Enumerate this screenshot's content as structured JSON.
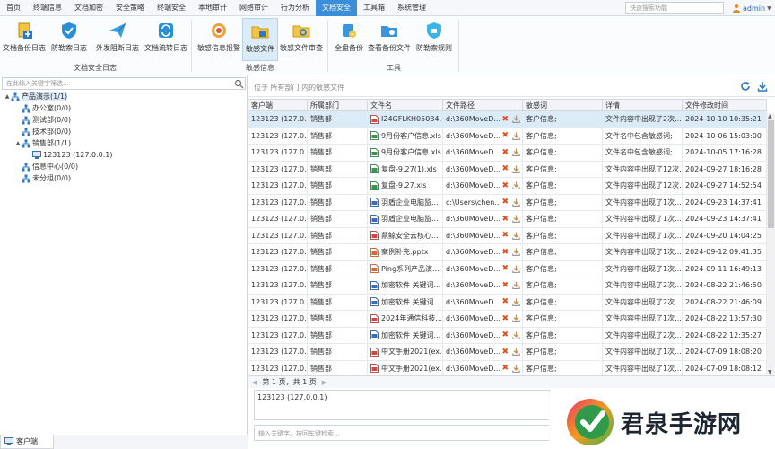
{
  "menu": {
    "items": [
      "首页",
      "终端信息",
      "文档加密",
      "安全策略",
      "终端安全",
      "本地审计",
      "网络审计",
      "行为分析",
      "文档安全",
      "工具箱",
      "系统管理"
    ],
    "active_index": 8,
    "quick_search_placeholder": "快速搜索功能",
    "user": "admin"
  },
  "ribbon": {
    "groups": [
      {
        "label": "文档安全日志",
        "buttons": [
          {
            "label": "文档备份日志",
            "icon": "doc-backup-icon"
          },
          {
            "label": "防勒索日志",
            "icon": "shield-icon"
          },
          {
            "label": "外发阻断日志",
            "icon": "paper-plane-icon"
          },
          {
            "label": "文档流转日志",
            "icon": "flow-icon"
          }
        ]
      },
      {
        "label": "敏感信息",
        "buttons": [
          {
            "label": "敏感信息报警",
            "icon": "alarm-icon"
          },
          {
            "label": "敏感文件",
            "icon": "folder-lock-icon",
            "active": true
          },
          {
            "label": "敏感文件审查",
            "icon": "folder-search-icon"
          }
        ]
      },
      {
        "label": "工具",
        "buttons": [
          {
            "label": "全盘备份",
            "icon": "disk-backup-icon"
          },
          {
            "label": "查看备份文件",
            "icon": "view-backup-icon"
          },
          {
            "label": "防勒索规则",
            "icon": "rule-icon"
          }
        ]
      }
    ]
  },
  "tree": {
    "search_placeholder": "在此输入关键字筛选...",
    "nodes": [
      {
        "label": "产品演示(1/1)",
        "level": 0,
        "expander": "▲",
        "icon": "org-icon",
        "selected": true
      },
      {
        "label": "办公室(0/0)",
        "level": 1,
        "expander": "",
        "icon": "org-icon"
      },
      {
        "label": "测试部(0/0)",
        "level": 1,
        "expander": "",
        "icon": "org-icon"
      },
      {
        "label": "技术部(0/0)",
        "level": 1,
        "expander": "",
        "icon": "org-icon"
      },
      {
        "label": "销售部(1/1)",
        "level": 1,
        "expander": "▲",
        "icon": "org-icon"
      },
      {
        "label": "123123 (127.0.0.1)",
        "level": 2,
        "expander": "",
        "icon": "computer-icon"
      },
      {
        "label": "信息中心(0/0)",
        "level": 1,
        "expander": "",
        "icon": "org-icon"
      },
      {
        "label": "未分组(0/0)",
        "level": 1,
        "expander": "",
        "icon": "org-icon"
      }
    ],
    "bottom_tab": "客户端"
  },
  "location": "位于 所有部门 内的敏感文件",
  "table": {
    "columns": [
      "客户端",
      "所属部门",
      "文件名",
      "文件路径",
      "敏感词",
      "详情",
      "文件修改时间"
    ],
    "rows": [
      {
        "client": "123123 (127.0...",
        "dept": "销售部",
        "file": "I24GFLKH05034...",
        "type": "pdf",
        "path": "d:\\360MoveD...",
        "word": "客户信息;",
        "detail": "文件内容中出现了2次...",
        "time": "2024-10-10 10:35:21"
      },
      {
        "client": "123123 (127.0...",
        "dept": "销售部",
        "file": "9月份客户信息.xls",
        "type": "xls",
        "path": "d:\\360MoveD...",
        "word": "客户信息;",
        "detail": "文件名中包含敏感词;",
        "time": "2024-10-06 15:03:00"
      },
      {
        "client": "123123 (127.0...",
        "dept": "销售部",
        "file": "9月份客户信息.xls",
        "type": "xls",
        "path": "d:\\360MoveD...",
        "word": "客户信息;",
        "detail": "文件名中包含敏感词;",
        "time": "2024-10-05 17:16:28"
      },
      {
        "client": "123123 (127.0...",
        "dept": "销售部",
        "file": "复盘-9.27(1).xls",
        "type": "xls",
        "path": "d:\\360MoveD...",
        "word": "客户信息;",
        "detail": "文件内容中出现了12次...",
        "time": "2024-09-27 18:16:28"
      },
      {
        "client": "123123 (127.0...",
        "dept": "销售部",
        "file": "复盘-9.27.xls",
        "type": "xls",
        "path": "d:\\360MoveD...",
        "word": "客户信息;",
        "detail": "文件内容中出现了12次...",
        "time": "2024-09-27 14:52:54"
      },
      {
        "client": "123123 (127.0...",
        "dept": "销售部",
        "file": "羽盾企业电脑监...",
        "type": "doc",
        "path": "c:\\Users\\chen...",
        "word": "客户信息;",
        "detail": "文件内容中出现了1次...",
        "time": "2024-09-23 14:37:41"
      },
      {
        "client": "123123 (127.0...",
        "dept": "销售部",
        "file": "羽盾企业电脑监...",
        "type": "doc",
        "path": "d:\\360MoveD...",
        "word": "客户信息;",
        "detail": "文件内容中出现了1次...",
        "time": "2024-09-23 14:37:41"
      },
      {
        "client": "123123 (127.0...",
        "dept": "销售部",
        "file": "鼎鲸安全云核心...",
        "type": "pdf",
        "path": "d:\\360MoveD...",
        "word": "客户信息;",
        "detail": "文件内容中出现了1次...",
        "time": "2024-09-20 14:04:25"
      },
      {
        "client": "123123 (127.0...",
        "dept": "销售部",
        "file": "案例补充.pptx",
        "type": "ppt",
        "path": "d:\\360MoveD...",
        "word": "客户信息;",
        "detail": "文件内容中出现了1次...",
        "time": "2024-09-12 09:41:35"
      },
      {
        "client": "123123 (127.0...",
        "dept": "销售部",
        "file": "Ping系列产品演...",
        "type": "ppt",
        "path": "d:\\360MoveD...",
        "word": "客户信息;",
        "detail": "文件内容中出现了1次...",
        "time": "2024-09-11 16:49:13"
      },
      {
        "client": "123123 (127.0...",
        "dept": "销售部",
        "file": "加密软件 关键词...",
        "type": "doc",
        "path": "d:\\360MoveD...",
        "word": "客户信息;",
        "detail": "文件内容中出现了2次...",
        "time": "2024-08-22 21:46:50"
      },
      {
        "client": "123123 (127.0...",
        "dept": "销售部",
        "file": "加密软件 关键词...",
        "type": "doc",
        "path": "d:\\360MoveD...",
        "word": "客户信息;",
        "detail": "文件内容中出现了2次...",
        "time": "2024-08-22 21:46:09"
      },
      {
        "client": "123123 (127.0...",
        "dept": "销售部",
        "file": "2024年通信科技...",
        "type": "pdf",
        "path": "d:\\360MoveD...",
        "word": "客户信息;",
        "detail": "文件内容中出现了1次...",
        "time": "2024-08-22 13:57:30"
      },
      {
        "client": "123123 (127.0...",
        "dept": "销售部",
        "file": "加密软件 关键词...",
        "type": "doc",
        "path": "d:\\360MoveD...",
        "word": "客户信息;",
        "detail": "文件内容中出现了2次...",
        "time": "2024-08-22 12:35:27"
      },
      {
        "client": "123123 (127.0...",
        "dept": "销售部",
        "file": "中文手册2021(ex...",
        "type": "pdf",
        "path": "d:\\360MoveD...",
        "word": "客户信息;",
        "detail": "文件内容中出现了1次...",
        "time": "2024-07-09 18:08:20"
      },
      {
        "client": "123123 (127.0...",
        "dept": "销售部",
        "file": "中文手册2021(ex...",
        "type": "pdf",
        "path": "d:\\360MoveD...",
        "word": "客户信息;",
        "detail": "文件内容中出现了1次...",
        "time": "2024-07-09 18:08:12"
      }
    ]
  },
  "pager": {
    "text": "第 1 页，共 1 页"
  },
  "detail_panel": {
    "text": "123123 (127.0.0.1)"
  },
  "message_input": {
    "placeholder": "输入关键字、按回车键检索..."
  },
  "watermark": {
    "text": "君泉手游网"
  },
  "colors": {
    "accent": "#3b8fd9",
    "selected_row": "#dcebf8",
    "pdf": "#d9433b",
    "xls": "#2e9a4a",
    "doc": "#2f6fc9",
    "ppt": "#e0662b"
  }
}
